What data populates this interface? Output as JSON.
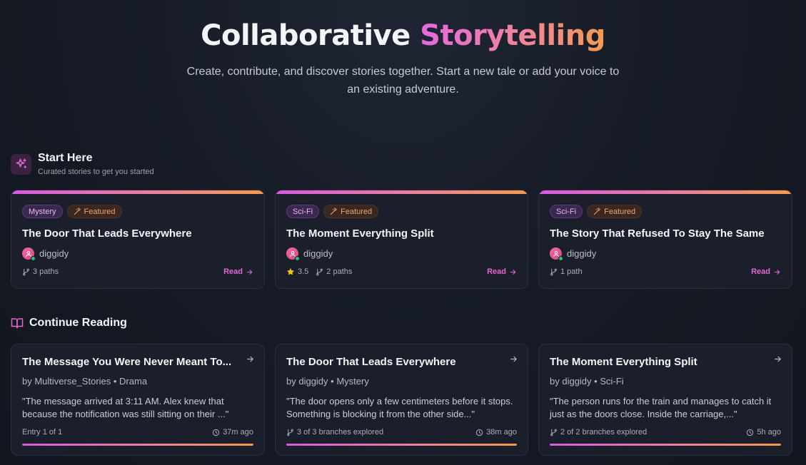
{
  "hero": {
    "title_main": "Collaborative ",
    "title_accent": "Storytelling",
    "subtitle": "Create, contribute, and discover stories together. Start a new tale or add your voice to an existing adventure."
  },
  "start_here": {
    "title": "Start Here",
    "subtitle": "Curated stories to get you started",
    "icon": "sparkles-icon",
    "cards": [
      {
        "genre": "Mystery",
        "featured": "Featured",
        "title": "The Door That Leads Everywhere",
        "author": "diggidy",
        "rating": "",
        "paths": "3 paths",
        "read": "Read"
      },
      {
        "genre": "Sci-Fi",
        "featured": "Featured",
        "title": "The Moment Everything Split",
        "author": "diggidy",
        "rating": "3.5",
        "paths": "2 paths",
        "read": "Read"
      },
      {
        "genre": "Sci-Fi",
        "featured": "Featured",
        "title": "The Story That Refused To Stay The Same",
        "author": "diggidy",
        "rating": "",
        "paths": "1 path",
        "read": "Read"
      }
    ]
  },
  "continue_reading": {
    "title": "Continue Reading",
    "icon": "book-open-icon",
    "cards": [
      {
        "title": "The Message You Were Never Meant To...",
        "byline": "by Multiverse_Stories • Drama",
        "excerpt": "\"The message arrived at 3:11 AM. Alex knew that because the notification was still sitting on their ...\"",
        "progress_text": "Entry 1 of 1",
        "time": "37m ago",
        "progress": 1.0
      },
      {
        "title": "The Door That Leads Everywhere",
        "byline": "by diggidy • Mystery",
        "excerpt": "\"The door opens only a few centimeters before it stops. Something is blocking it from the other side...\"",
        "progress_text": "3 of 3 branches explored",
        "time": "38m ago",
        "progress": 1.0
      },
      {
        "title": "The Moment Everything Split",
        "byline": "by diggidy • Sci-Fi",
        "excerpt": "\"The person runs for the train and manages to catch it just as the doors close. Inside the carriage,...\"",
        "progress_text": "2 of 2 branches explored",
        "time": "5h ago",
        "progress": 1.0
      }
    ]
  },
  "colors": {
    "accent_pink": "#e366d6",
    "accent_orange": "#f59a4e",
    "background": "#151a24",
    "card": "#1a1f2b",
    "star": "#f5c518",
    "online": "#22c55e"
  }
}
